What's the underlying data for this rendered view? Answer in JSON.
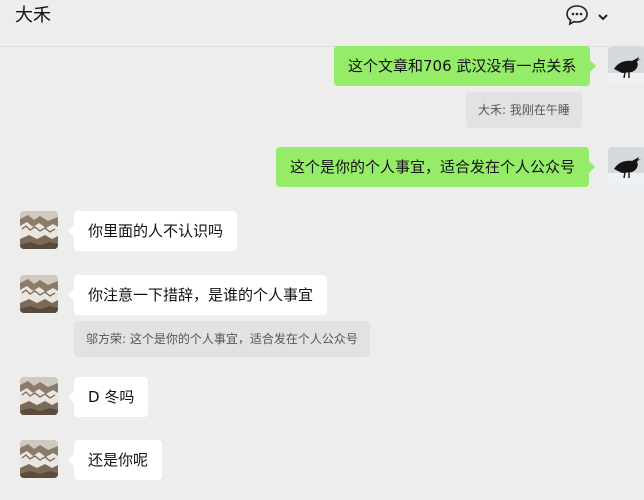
{
  "header": {
    "title": "大禾",
    "chat_icon": "chat-bubble-icon",
    "menu_icon": "chevron-down-icon"
  },
  "messages": [
    {
      "direction": "out",
      "text": "这个文章和706 武汉没有一点关系",
      "avatar": "crow-avatar"
    },
    {
      "direction": "quote-out",
      "text": "大禾: 我刚在午睡"
    },
    {
      "direction": "out",
      "text": "这个是你的个人事宜，适合发在个人公众号",
      "avatar": "crow-avatar"
    },
    {
      "direction": "in",
      "text": "你里面的人不认识吗",
      "avatar": "landscape-avatar"
    },
    {
      "direction": "in",
      "text": "你注意一下措辞，是谁的个人事宜",
      "avatar": "landscape-avatar"
    },
    {
      "direction": "quote-in",
      "text": "邬方荣: 这个是你的个人事宜，适合发在个人公众号"
    },
    {
      "direction": "in",
      "text": "D 冬吗",
      "avatar": "landscape-avatar"
    },
    {
      "direction": "in",
      "text": "还是你呢",
      "avatar": "landscape-avatar"
    }
  ],
  "colors": {
    "outgoing_bubble": "#95ec69",
    "incoming_bubble": "#ffffff",
    "background": "#ededed",
    "quote_background": "#e2e2e2"
  }
}
